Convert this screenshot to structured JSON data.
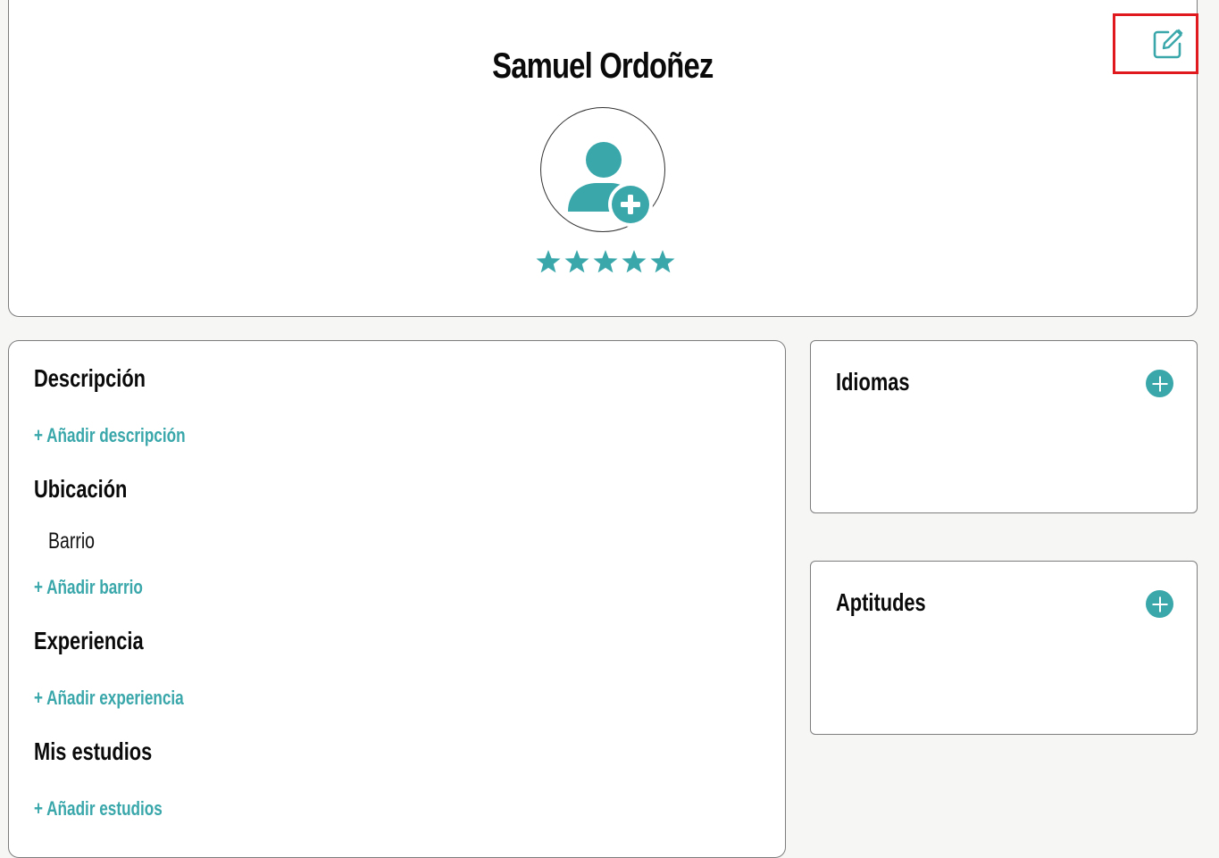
{
  "profile": {
    "name": "Samuel Ordoñez",
    "rating": 5,
    "rating_max": 5
  },
  "main": {
    "description": {
      "title": "Descripción",
      "add_label": "+ Añadir descripción"
    },
    "location": {
      "title": "Ubicación",
      "field_label": "Barrio",
      "add_label": "+ Añadir barrio"
    },
    "experience": {
      "title": "Experiencia",
      "add_label": "+ Añadir experiencia"
    },
    "studies": {
      "title": "Mis estudios",
      "add_label": "+ Añadir estudios"
    }
  },
  "sidebar": {
    "languages": {
      "title": "Idiomas"
    },
    "skills": {
      "title": "Aptitudes"
    }
  },
  "icons": {
    "edit": "edit-icon",
    "avatar": "add-user-icon",
    "star": "star-icon",
    "add": "plus-circle-icon"
  },
  "colors": {
    "accent": "#3aa7ab",
    "highlight": "#e0191f",
    "background": "#f6f6f5"
  }
}
